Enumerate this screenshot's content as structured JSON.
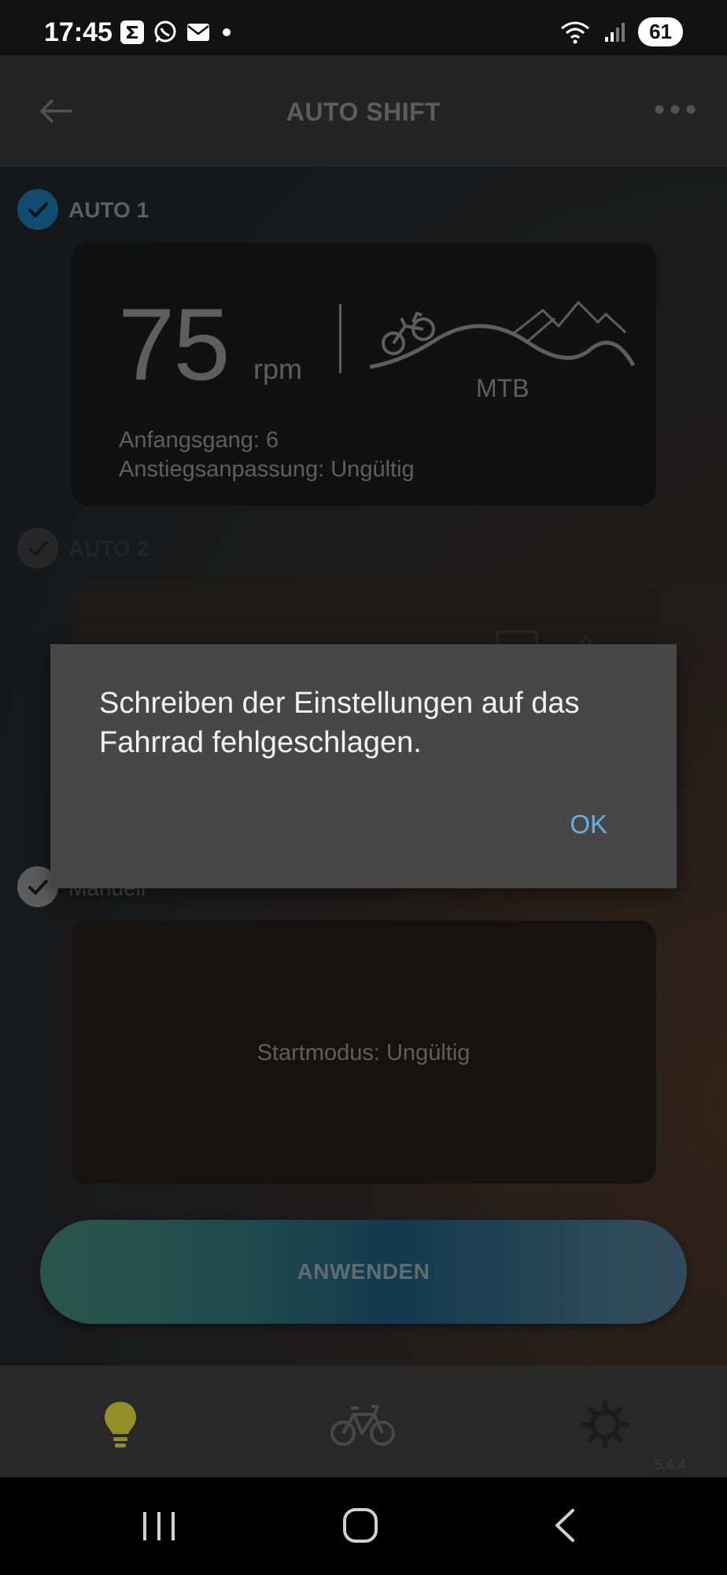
{
  "status_bar": {
    "time": "17:45",
    "battery": "61",
    "icons_left": [
      "sigma-app-icon",
      "whatsapp-icon",
      "mail-icon",
      "dot-icon"
    ],
    "icons_right": [
      "wifi-icon",
      "signal-icon",
      "battery-icon"
    ]
  },
  "header": {
    "title": "AUTO SHIFT"
  },
  "auto1": {
    "label": "AUTO 1",
    "rpm_value": "75",
    "rpm_unit": "rpm",
    "terrain": "MTB",
    "start_gear": "Anfangsgang: 6",
    "climb_adjust": "Anstiegsanpassung: Ungültig"
  },
  "auto2": {
    "label": "AUTO 2"
  },
  "manual": {
    "label": "Manuell",
    "start_mode": "Startmodus: Ungültig"
  },
  "apply_button": {
    "label": "ANWENDEN"
  },
  "bottom_nav": {
    "items": [
      "lightbulb-icon",
      "bicycle-icon",
      "gear-icon"
    ],
    "version": "5.4.4"
  },
  "dialog": {
    "message": "Schreiben der Einstellungen auf das Fahrrad fehlgeschlagen.",
    "ok_label": "OK"
  },
  "colors": {
    "accent_check": "#1a6fa3",
    "dialog_button": "#64b0e8",
    "bulb": "#d9d23a"
  }
}
